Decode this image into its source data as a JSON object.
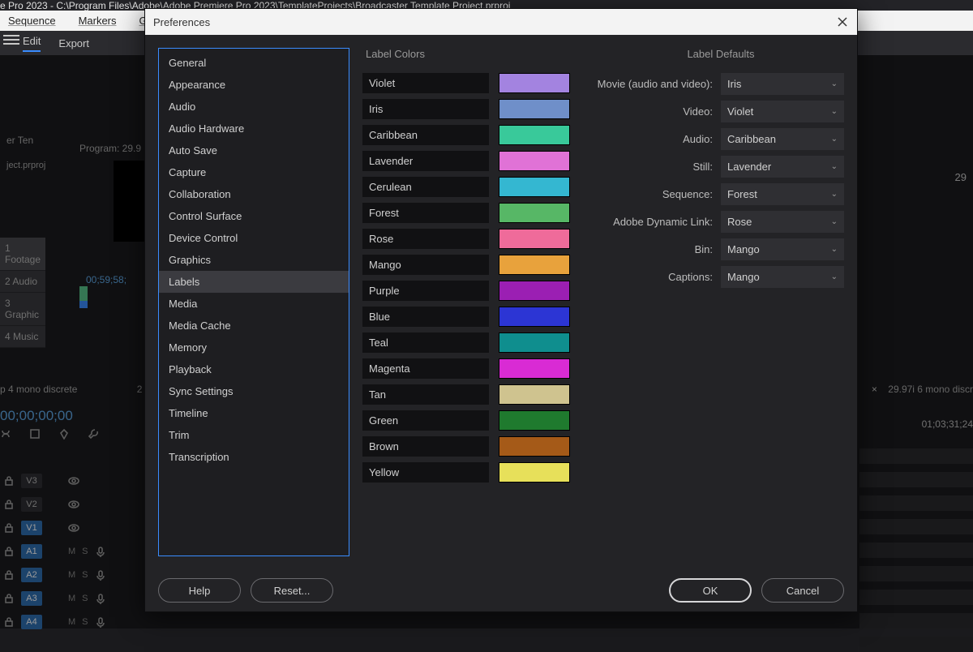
{
  "app": {
    "title_fragment": "e Pro 2023 - C:\\Program Files\\Adobe\\Adobe Premiere Pro 2023\\TemplateProjects\\Broadcaster Template Project.prproj",
    "menus": [
      "Sequence",
      "Markers",
      "Grap"
    ],
    "workspace": {
      "items": [
        "Edit",
        "Export"
      ],
      "selected": 0
    },
    "bg": {
      "program_label": "Program: 29.9",
      "tc1": "00;59;58;",
      "proj_text": "ject.prproj",
      "ter_ten": "er Ten",
      "bins": [
        "1 Footage",
        "2 Audio",
        "3 Graphic",
        "4 Music"
      ],
      "seq_name": "p 4 mono discrete",
      "seq_num": "2",
      "seq_tc": "00;00;00;00",
      "right_num": "29",
      "right_seq_full": "29.97i 6 mono discr",
      "right_tc": "01;03;31;24"
    },
    "tracks": {
      "video": [
        "V3",
        "V2",
        "V1"
      ],
      "audio": [
        "A1",
        "A2",
        "A3",
        "A4"
      ]
    }
  },
  "dialog": {
    "title": "Preferences",
    "categories": [
      "General",
      "Appearance",
      "Audio",
      "Audio Hardware",
      "Auto Save",
      "Capture",
      "Collaboration",
      "Control Surface",
      "Device Control",
      "Graphics",
      "Labels",
      "Media",
      "Media Cache",
      "Memory",
      "Playback",
      "Sync Settings",
      "Timeline",
      "Trim",
      "Transcription"
    ],
    "selected_category": "Labels",
    "headings": {
      "colors": "Label Colors",
      "defaults": "Label Defaults"
    },
    "label_colors": [
      {
        "name": "Violet",
        "hex": "#a383e0"
      },
      {
        "name": "Iris",
        "hex": "#6f8fc9"
      },
      {
        "name": "Caribbean",
        "hex": "#39c99a"
      },
      {
        "name": "Lavender",
        "hex": "#e072d6"
      },
      {
        "name": "Cerulean",
        "hex": "#34b7d1"
      },
      {
        "name": "Forest",
        "hex": "#57b766"
      },
      {
        "name": "Rose",
        "hex": "#ef6b9a"
      },
      {
        "name": "Mango",
        "hex": "#e8a23c"
      },
      {
        "name": "Purple",
        "hex": "#9b1fb3"
      },
      {
        "name": "Blue",
        "hex": "#2c35d4"
      },
      {
        "name": "Teal",
        "hex": "#0f8e8e"
      },
      {
        "name": "Magenta",
        "hex": "#d92bd4"
      },
      {
        "name": "Tan",
        "hex": "#cfc38f"
      },
      {
        "name": "Green",
        "hex": "#1f7a2e"
      },
      {
        "name": "Brown",
        "hex": "#a55a18"
      },
      {
        "name": "Yellow",
        "hex": "#e7e05a"
      }
    ],
    "label_defaults": [
      {
        "label": "Movie (audio and video):",
        "value": "Iris"
      },
      {
        "label": "Video:",
        "value": "Violet"
      },
      {
        "label": "Audio:",
        "value": "Caribbean"
      },
      {
        "label": "Still:",
        "value": "Lavender"
      },
      {
        "label": "Sequence:",
        "value": "Forest"
      },
      {
        "label": "Adobe Dynamic Link:",
        "value": "Rose"
      },
      {
        "label": "Bin:",
        "value": "Mango"
      },
      {
        "label": "Captions:",
        "value": "Mango"
      }
    ],
    "buttons": {
      "help": "Help",
      "reset": "Reset...",
      "ok": "OK",
      "cancel": "Cancel"
    }
  }
}
